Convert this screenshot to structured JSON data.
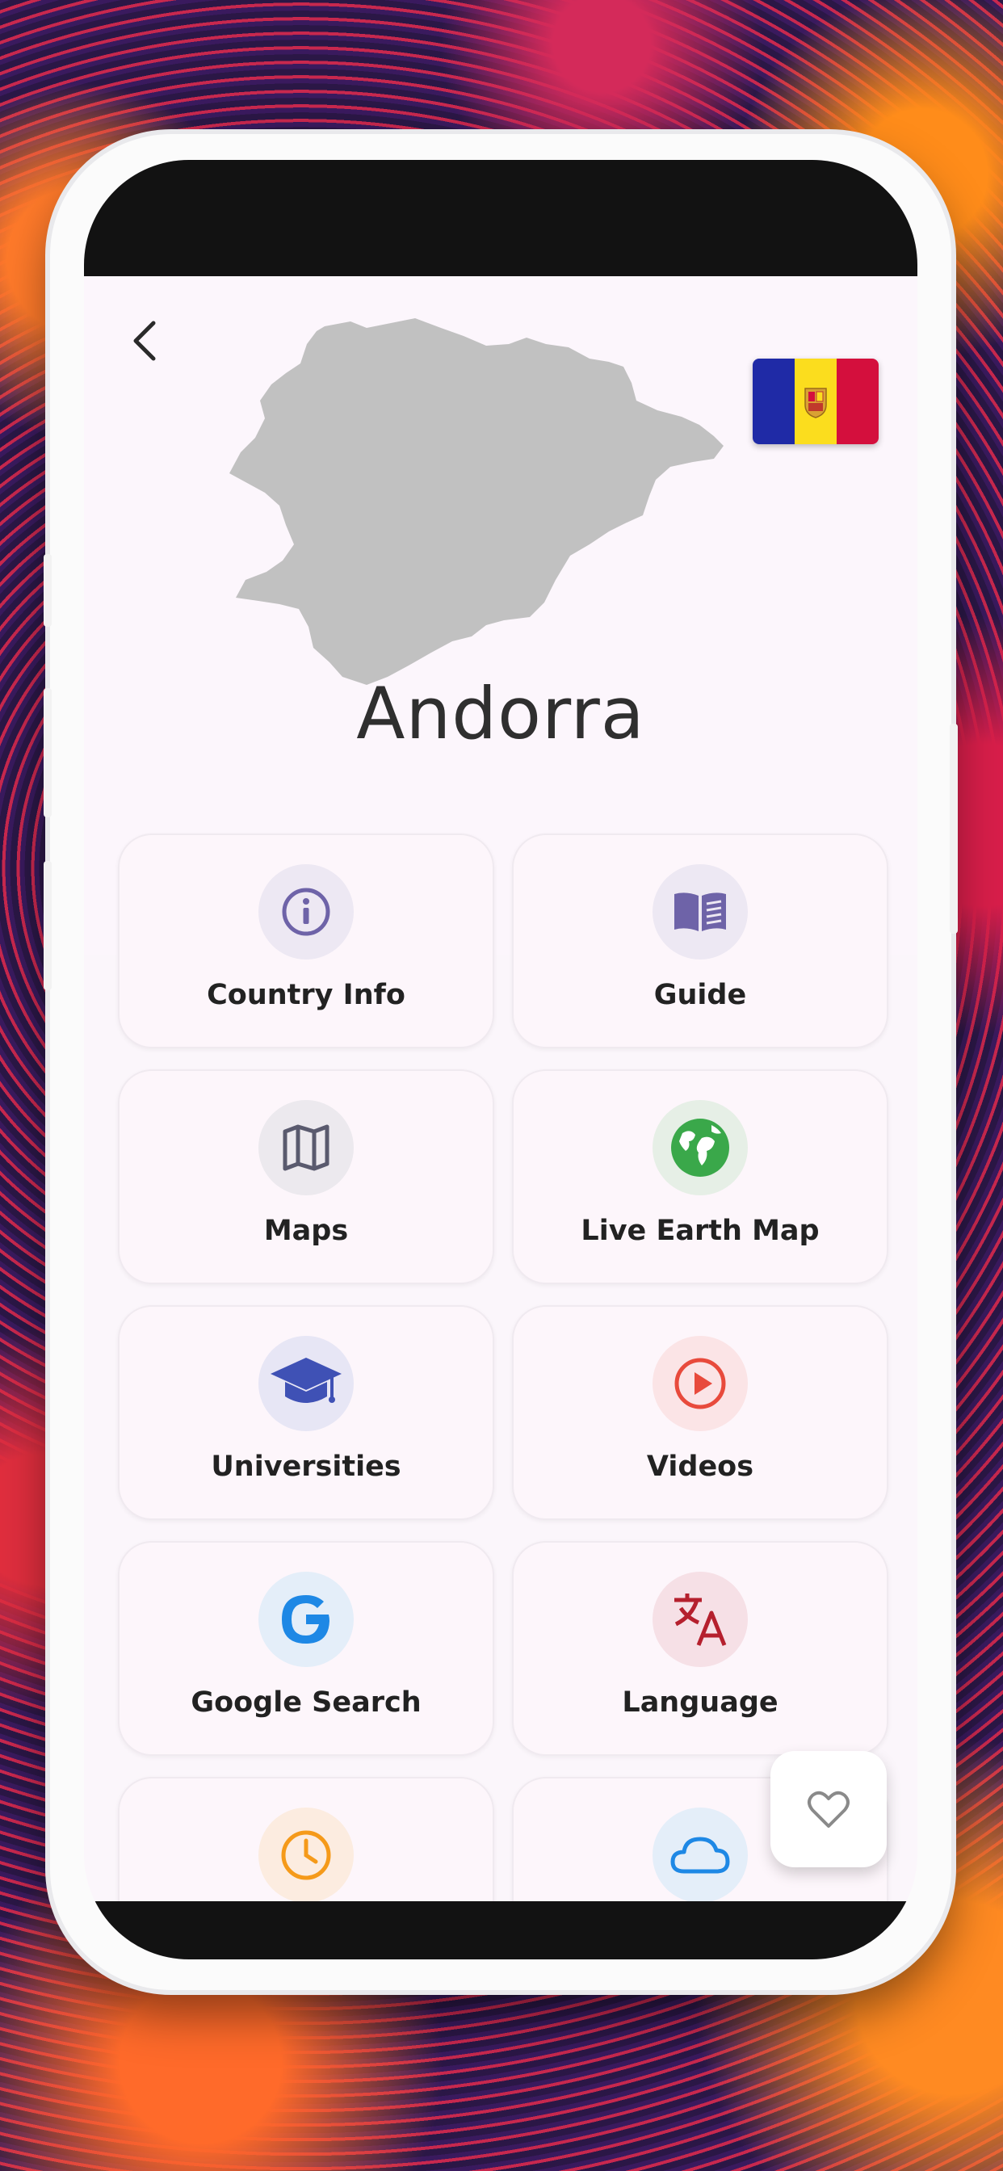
{
  "country": {
    "name": "Andorra"
  },
  "flag": {
    "colors": [
      "#1f2aa6",
      "#fbdd1e",
      "#d40f3d"
    ],
    "emblem": "coat-of-arms"
  },
  "colors": {
    "accent_purple": "#6e63a8",
    "map_gray": "#c1c1c1"
  },
  "menu": {
    "items": [
      {
        "label": "Country Info",
        "icon": "info-icon",
        "color": "#6e63a8",
        "bg": "#ede8f3"
      },
      {
        "label": "Guide",
        "icon": "book-icon",
        "color": "#6e63a8",
        "bg": "#ede8f3"
      },
      {
        "label": "Maps",
        "icon": "map-icon",
        "color": "#5a5a6e",
        "bg": "#ece9ee"
      },
      {
        "label": "Live Earth Map",
        "icon": "globe-icon",
        "color": "#3aa84a",
        "bg": "#e6efe6"
      },
      {
        "label": "Universities",
        "icon": "graduation-cap-icon",
        "color": "#3f51b5",
        "bg": "#e7e6f5"
      },
      {
        "label": "Videos",
        "icon": "play-icon",
        "color": "#e84a3c",
        "bg": "#fbe4e6"
      },
      {
        "label": "Google Search",
        "icon": "google-icon",
        "color": "#1e88e5",
        "bg": "#e4eef9"
      },
      {
        "label": "Language",
        "icon": "translate-icon",
        "color": "#b5202e",
        "bg": "#f6e0e6"
      },
      {
        "label": "",
        "icon": "clock-icon",
        "color": "#f59a1a",
        "bg": "#fcece0"
      },
      {
        "label": "",
        "icon": "cloud-icon",
        "color": "#1e88e5",
        "bg": "#e4eef9"
      }
    ]
  },
  "fab": {
    "icon": "heart-icon"
  }
}
